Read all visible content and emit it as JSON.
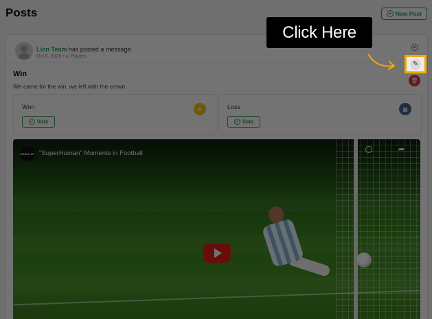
{
  "header": {
    "title": "Posts",
    "new_post_label": "New Post"
  },
  "post": {
    "author": "Lion Team",
    "action_text": " has posted a message.",
    "meta": "Oct 6, 2025 • ∞ Players",
    "title": "Win",
    "body": "We came for the win, we left with the crown."
  },
  "poll": {
    "options": [
      {
        "label": "Won",
        "vote_label": "Vote"
      },
      {
        "label": "Loss",
        "vote_label": "Vote"
      }
    ]
  },
  "video": {
    "channel": "GREEK MT",
    "title": "\"SuperHuman\" Moments in Football"
  },
  "tutorial": {
    "callout_text": "Click Here",
    "highlight_color": "#f5a800"
  },
  "icons": {
    "edit": "pencil-icon",
    "delete": "trash-icon",
    "settings": "gear-icon",
    "play": "play-icon"
  }
}
